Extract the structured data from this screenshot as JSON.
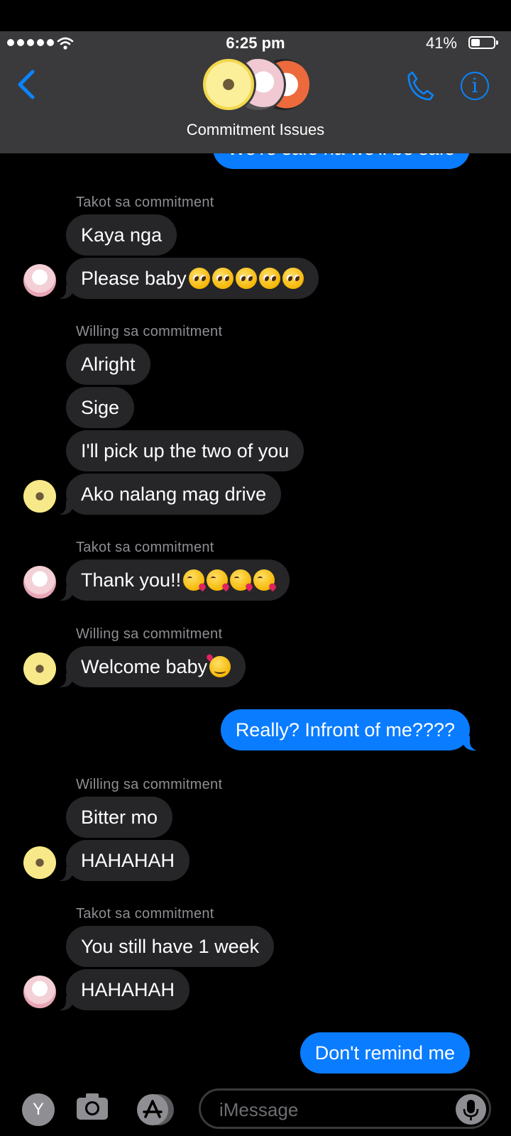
{
  "status_bar": {
    "time": "6:25 pm",
    "battery": "41%",
    "battery_level": 0.41
  },
  "header": {
    "title": "Commitment Issues"
  },
  "messages": {
    "partial_top": "We're safe na we'll be safe",
    "s1": "Takot sa commitment",
    "m1": "Kaya nga",
    "m2": "Please baby",
    "s2": "Willing sa commitment",
    "m3": "Alright",
    "m4": "Sige",
    "m5": "I'll pick up the two of you",
    "m6": "Ako nalang mag drive",
    "s3": "Takot sa commitment",
    "m7": "Thank you!!",
    "s4": "Willing sa commitment",
    "m8": "Welcome baby",
    "m9": "Really? Infront of me????",
    "s5": "Willing sa commitment",
    "m10": "Bitter mo",
    "m11": "HAHAHAH",
    "s6": "Takot sa commitment",
    "m12": "You still have 1 week",
    "m13": "HAHAHAH",
    "m14": "Don't remind me"
  },
  "input_bar": {
    "app_badge": "Y",
    "placeholder": "iMessage"
  },
  "colors": {
    "accent": "#0a84ff",
    "outgoing_bubble": "#0a7cff",
    "incoming_bubble": "#262629",
    "header_bg": "#3a3a3c"
  }
}
